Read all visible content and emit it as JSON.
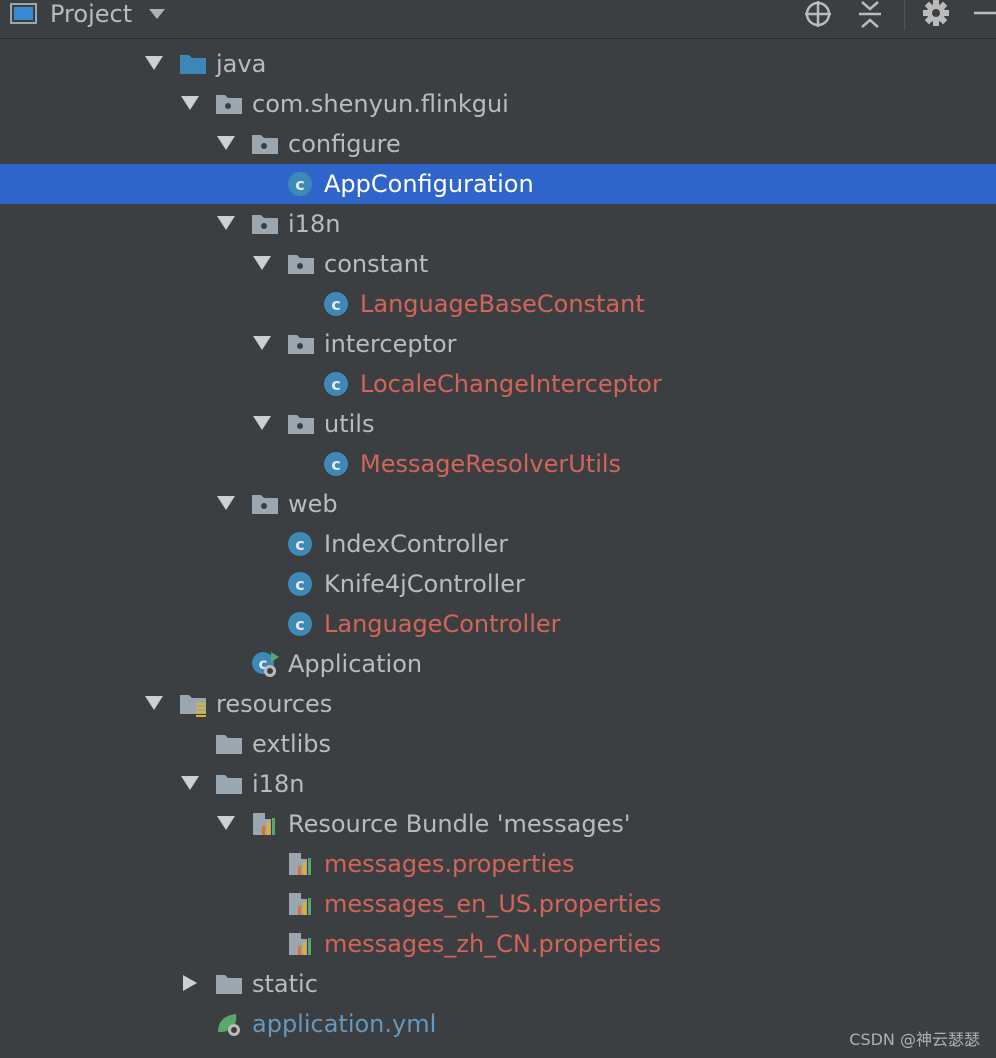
{
  "toolbar": {
    "title": "Project",
    "icons": [
      "project-view-icon",
      "dropdown-caret-icon",
      "locate-icon",
      "collapse-all-icon",
      "gear-icon",
      "minimize-icon"
    ]
  },
  "tree": {
    "items": [
      {
        "label": "java",
        "kind": "source-folder",
        "expanded": true
      },
      {
        "label": "com.shenyun.flinkgui",
        "kind": "package",
        "expanded": true
      },
      {
        "label": "configure",
        "kind": "package",
        "expanded": true
      },
      {
        "label": "AppConfiguration",
        "kind": "class",
        "status": "selected"
      },
      {
        "label": "i18n",
        "kind": "package",
        "expanded": true
      },
      {
        "label": "constant",
        "kind": "package",
        "expanded": true
      },
      {
        "label": "LanguageBaseConstant",
        "kind": "class",
        "status": "unversioned"
      },
      {
        "label": "interceptor",
        "kind": "package",
        "expanded": true
      },
      {
        "label": "LocaleChangeInterceptor",
        "kind": "class",
        "status": "unversioned"
      },
      {
        "label": "utils",
        "kind": "package",
        "expanded": true
      },
      {
        "label": "MessageResolverUtils",
        "kind": "class",
        "status": "unversioned"
      },
      {
        "label": "web",
        "kind": "package",
        "expanded": true
      },
      {
        "label": "IndexController",
        "kind": "class",
        "status": "normal"
      },
      {
        "label": "Knife4jController",
        "kind": "class",
        "status": "normal"
      },
      {
        "label": "LanguageController",
        "kind": "class",
        "status": "unversioned"
      },
      {
        "label": "Application",
        "kind": "spring-boot-class",
        "status": "normal"
      },
      {
        "label": "resources",
        "kind": "resources-folder",
        "expanded": true
      },
      {
        "label": "extlibs",
        "kind": "folder"
      },
      {
        "label": "i18n",
        "kind": "folder",
        "expanded": true
      },
      {
        "label": "Resource Bundle 'messages'",
        "kind": "resource-bundle",
        "expanded": true
      },
      {
        "label": "messages.properties",
        "kind": "properties-file",
        "status": "unversioned"
      },
      {
        "label": "messages_en_US.properties",
        "kind": "properties-file",
        "status": "unversioned"
      },
      {
        "label": "messages_zh_CN.properties",
        "kind": "properties-file",
        "status": "unversioned"
      },
      {
        "label": "static",
        "kind": "folder",
        "expanded": false
      },
      {
        "label": "application.yml",
        "kind": "spring-yml",
        "status": "modified"
      }
    ]
  },
  "colors": {
    "background": "#3c3f41",
    "selection": "#2f65ca",
    "normal_text": "#bbbbbb",
    "unversioned_text": "#d2645a",
    "modified_text": "#6897bb",
    "class_icon": "#3d8ab8"
  },
  "watermark": "CSDN @神云瑟瑟"
}
